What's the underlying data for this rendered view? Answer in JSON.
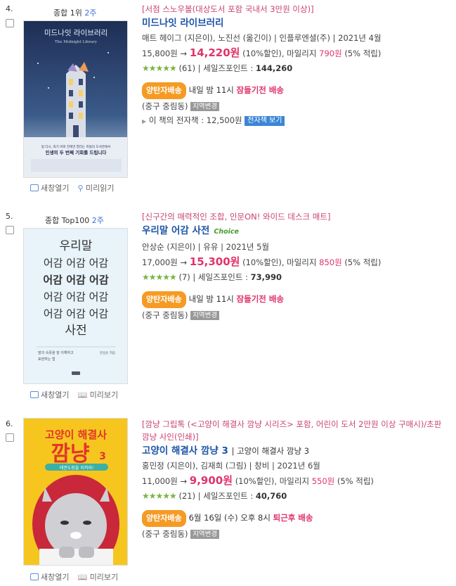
{
  "items": [
    {
      "rank": "4.",
      "rank_tag": "종합 1위",
      "rank_week": "2주",
      "event": "[서점 스노우볼(대상도서 포함 국내서 3만원 이상)]",
      "title": "미드나잇 라이브러리",
      "subtitle": "",
      "choice": "",
      "meta": "매트 헤이그 (지은이), 노진선 (옮긴이) | 인플루엔셜(주) | 2021년 4월",
      "list_price": "15,800원",
      "arrow": "→",
      "sale_price": "14,220원",
      "discount": "(10%할인),",
      "mileage_label": "마일리지",
      "mileage": "790원",
      "mileage_rate": "(5% 적립)",
      "stars": "★★★★★",
      "review_count": "(61)",
      "sales_point_label": "| 세일즈포인트 :",
      "sales_point": "144,260",
      "delivery_badge": "양탄자배송",
      "delivery_time": "내일 밤 11시",
      "delivery_type": "잠들기전 배송",
      "region": "(중구 중림동)",
      "region_button": "지역변경",
      "ebook_text": "이 책의 전자책 : 12,500원",
      "ebook_button": "전자책 보기",
      "link_new": "새창열기",
      "link_preview": "미리읽기",
      "cover": {
        "title": "미드나잇 라이브러리",
        "en": "The Midnight Library",
        "tagline1": "빛 다시, 죽기 바로 전에만 열리는 마법의 도서관에서",
        "tagline2": "인생의 두 번째 기회를 드립니다"
      }
    },
    {
      "rank": "5.",
      "rank_tag": "종합 Top100",
      "rank_week": "2주",
      "event": "[신구간의 매력적인 조합, 인문ON! 와이드 데스크 매트]",
      "title": "우리말 어감 사전",
      "subtitle": "",
      "choice": "Choice",
      "meta": "안상순 (지은이) | 유유 | 2021년 5월",
      "list_price": "17,000원",
      "arrow": "→",
      "sale_price": "15,300원",
      "discount": "(10%할인),",
      "mileage_label": "마일리지",
      "mileage": "850원",
      "mileage_rate": "(5% 적립)",
      "stars": "★★★★★",
      "review_count": "(7)",
      "sales_point_label": "| 세일즈포인트 :",
      "sales_point": "73,990",
      "delivery_badge": "양탄자배송",
      "delivery_time": "내일 밤 11시",
      "delivery_type": "잠들기전 배송",
      "region": "(중구 중림동)",
      "region_button": "지역변경",
      "link_new": "새창열기",
      "link_preview": "미리보기",
      "cover": {
        "l1": "우리말",
        "l2": "어감 어감 어감",
        "l3": "어감 어감 어감",
        "l4": "어감 어감 어감",
        "l5": "어감 어감 어감",
        "l6": "사전",
        "foot1": "말의 속뜻을 잘 이해하고",
        "foot2": "표현하는 법",
        "author": "안상순 지음"
      }
    },
    {
      "rank": "6.",
      "rank_tag": "",
      "rank_week": "",
      "event": "[깜냥 그립톡 (<고양이 해결사 깜냥 시리즈> 포함, 어린이 도서 2만원 이상 구매시)/초판 깜냥 사인(인쇄)]",
      "title": "고양이 해결사 깜냥 3",
      "subtitle": "| 고양이 해결사 깜냥 3",
      "choice": "",
      "meta": "홍민정 (지은이), 김재희 (그림) | 창비 | 2021년 6월",
      "list_price": "11,000원",
      "arrow": "→",
      "sale_price": "9,900원",
      "discount": "(10%할인),",
      "mileage_label": "마일리지",
      "mileage": "550원",
      "mileage_rate": "(5% 적립)",
      "stars": "★★★★★",
      "review_count": "(21)",
      "sales_point_label": "| 세일즈포인트 :",
      "sales_point": "40,760",
      "delivery_badge": "양탄자배송",
      "delivery_time": "6월 16일 (수) 오후 8시",
      "delivery_type": "퇴근후 배송",
      "region": "(중구 중림동)",
      "region_button": "지역변경",
      "link_new": "새창열기",
      "link_preview": "미리보기",
      "cover": {
        "series": "고양이 해결사",
        "name": "깜냥",
        "num": "3",
        "band": "태권도장을 지켜라!"
      }
    }
  ],
  "colors": {
    "title": "#1c54a8",
    "event": "#c8436f",
    "sale": "#e0346a",
    "badge": "#f59b24",
    "stars": "#7cb342"
  }
}
